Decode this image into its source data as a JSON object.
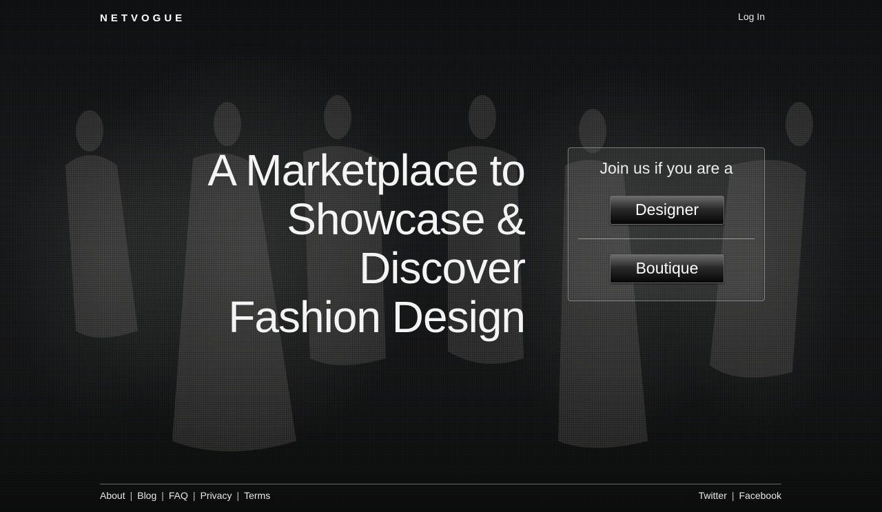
{
  "header": {
    "logo": "NETVOGUE",
    "login_label": "Log In"
  },
  "hero": {
    "line1": "A Marketplace to",
    "line2": "Showcase & Discover",
    "line3": "Fashion Design"
  },
  "join": {
    "title": "Join us if you are a",
    "designer_label": "Designer",
    "boutique_label": "Boutique"
  },
  "footer": {
    "links_left": [
      "About",
      "Blog",
      "FAQ",
      "Privacy",
      "Terms"
    ],
    "links_right": [
      "Twitter",
      "Facebook"
    ],
    "separator": "|"
  },
  "colors": {
    "background": "#111213",
    "text": "#ffffff"
  }
}
